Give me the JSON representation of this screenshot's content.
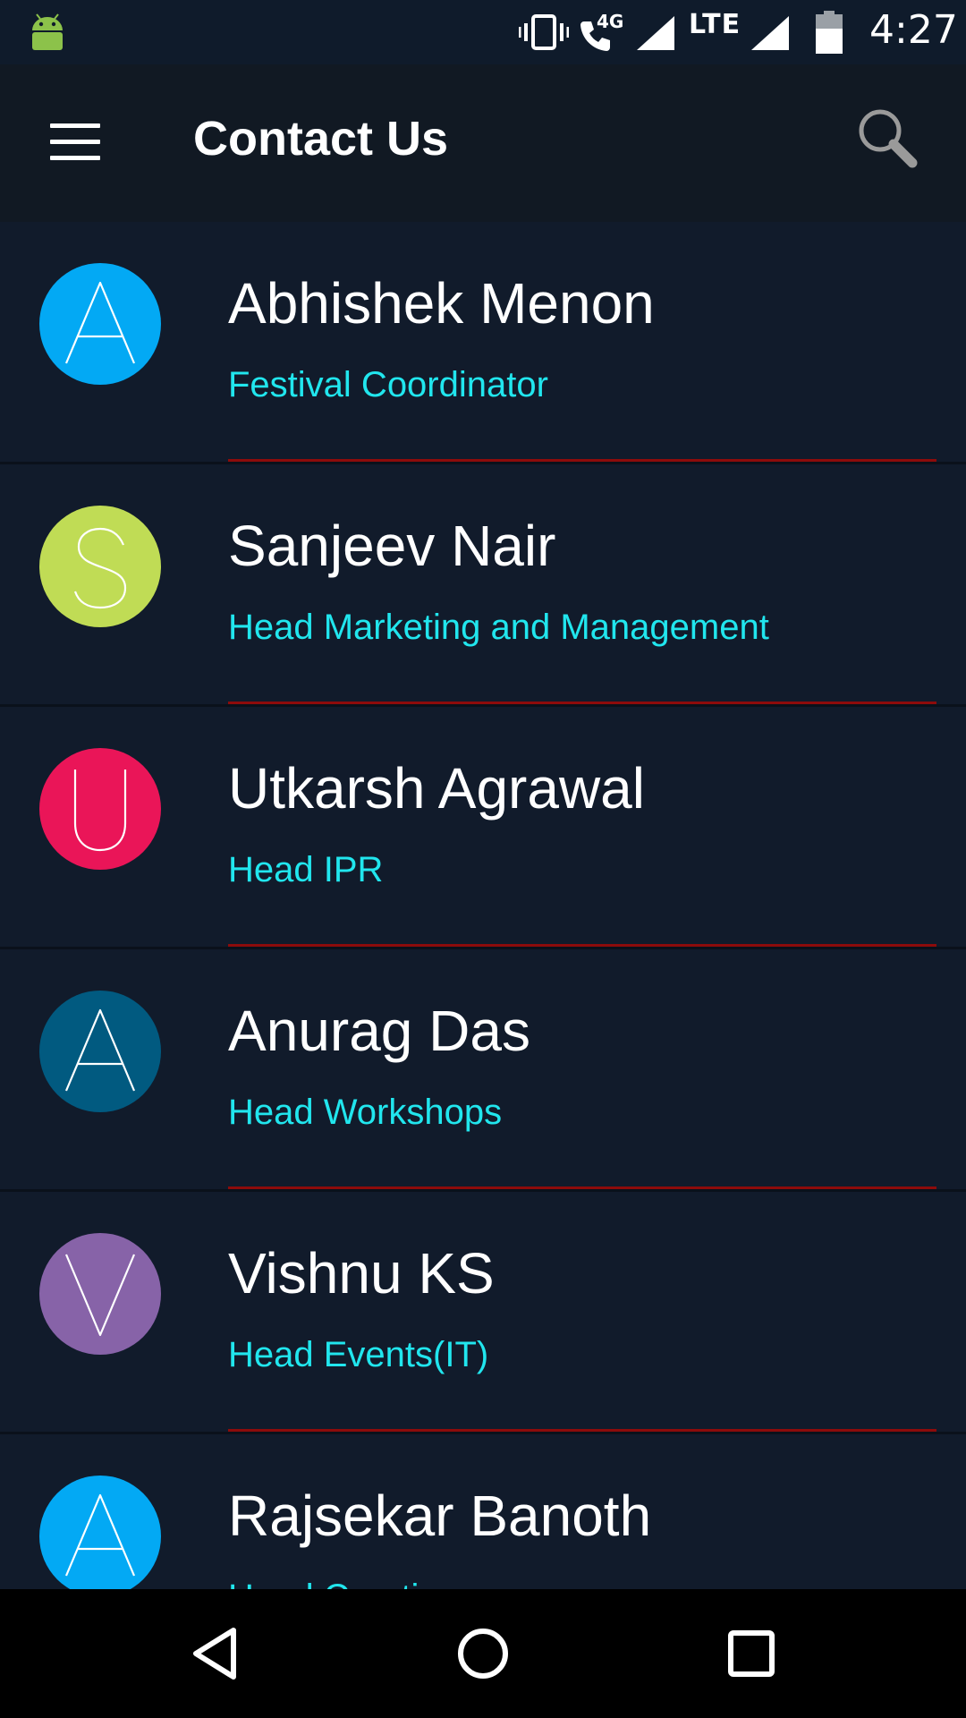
{
  "status_bar": {
    "time": "4:27",
    "network_label": "LTE",
    "call_label": "4G",
    "icons": [
      "android-icon",
      "vibrate-icon",
      "wifi-call-icon",
      "signal-icon",
      "signal-icon",
      "battery-icon"
    ]
  },
  "app_bar": {
    "title": "Contact Us",
    "menu_icon": "hamburger-menu-icon",
    "search_icon": "search-icon"
  },
  "contacts": [
    {
      "letter": "A",
      "name": "Abhishek Menon",
      "role": "Festival Coordinator",
      "color": "#03a9f4"
    },
    {
      "letter": "S",
      "name": "Sanjeev Nair",
      "role": "Head Marketing and Management",
      "color": "#c0dc55"
    },
    {
      "letter": "U",
      "name": "Utkarsh Agrawal",
      "role": "Head IPR",
      "color": "#ea1558"
    },
    {
      "letter": "A",
      "name": "Anurag Das",
      "role": "Head Workshops",
      "color": "#015a80"
    },
    {
      "letter": "V",
      "name": "Vishnu KS",
      "role": "Head Events(IT)",
      "color": "#8763a8"
    },
    {
      "letter": "A",
      "name": "Rajsekar Banoth",
      "role": "Head Creative",
      "color": "#03a9f4"
    }
  ],
  "colors": {
    "background": "#101a29",
    "role_text": "#21e6ee",
    "divider": "#8d0b0b"
  },
  "nav_bar": {
    "icons": [
      "back-icon",
      "home-icon",
      "recents-icon"
    ]
  }
}
